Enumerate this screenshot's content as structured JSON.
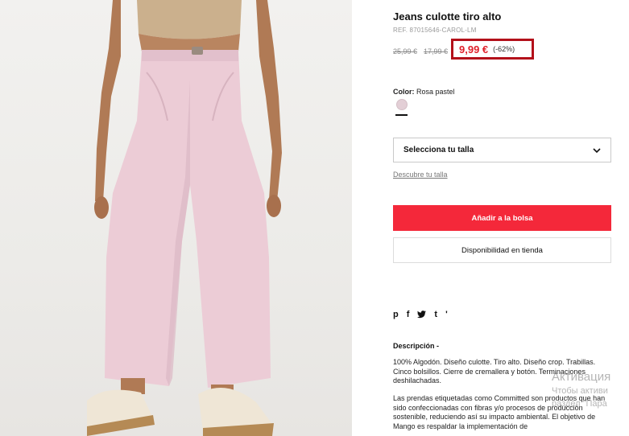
{
  "product": {
    "title": "Jeans culotte tiro alto",
    "ref": "REF. 87015646-CAROL-LM",
    "price_original": "25,99 €",
    "price_previous": "17,99 €",
    "price_sale": "9,99 €",
    "discount": "(-62%)",
    "color_label": "Color:",
    "color_value": "Rosa pastel",
    "swatch_color": "#e3cfd6"
  },
  "size": {
    "select_label": "Selecciona tu talla",
    "guide_link": "Descubre tu talla"
  },
  "actions": {
    "add_to_bag": "Añadir a la bolsa",
    "store_availability": "Disponibilidad en tienda"
  },
  "share": {
    "pinterest": "p",
    "facebook": "f",
    "twitter": "t",
    "tumblr": "t",
    "more": "'"
  },
  "description": {
    "title": "Descripción  -",
    "paragraph1": "100% Algodón. Diseño culotte. Tiro alto. Diseño crop. Trabillas. Cinco bolsillos. Cierre de cremallera y botón. Terminaciones deshilachadas.",
    "paragraph2": "Las prendas etiquetadas como Committed son productos que han sido confeccionadas con fibras y/o procesos de producción sostenible, reduciendo así su impacto ambiental. El objetivo de Mango es respaldar la implementación de"
  },
  "watermark": {
    "line1": "Активация",
    "line2": "Чтобы активи",
    "line3": "раздел \"Пара"
  },
  "colors": {
    "accent_red": "#f4283a",
    "sale_red": "#e0202a",
    "highlight_box": "#b3101a",
    "pants_pink": "#ecccd6"
  }
}
